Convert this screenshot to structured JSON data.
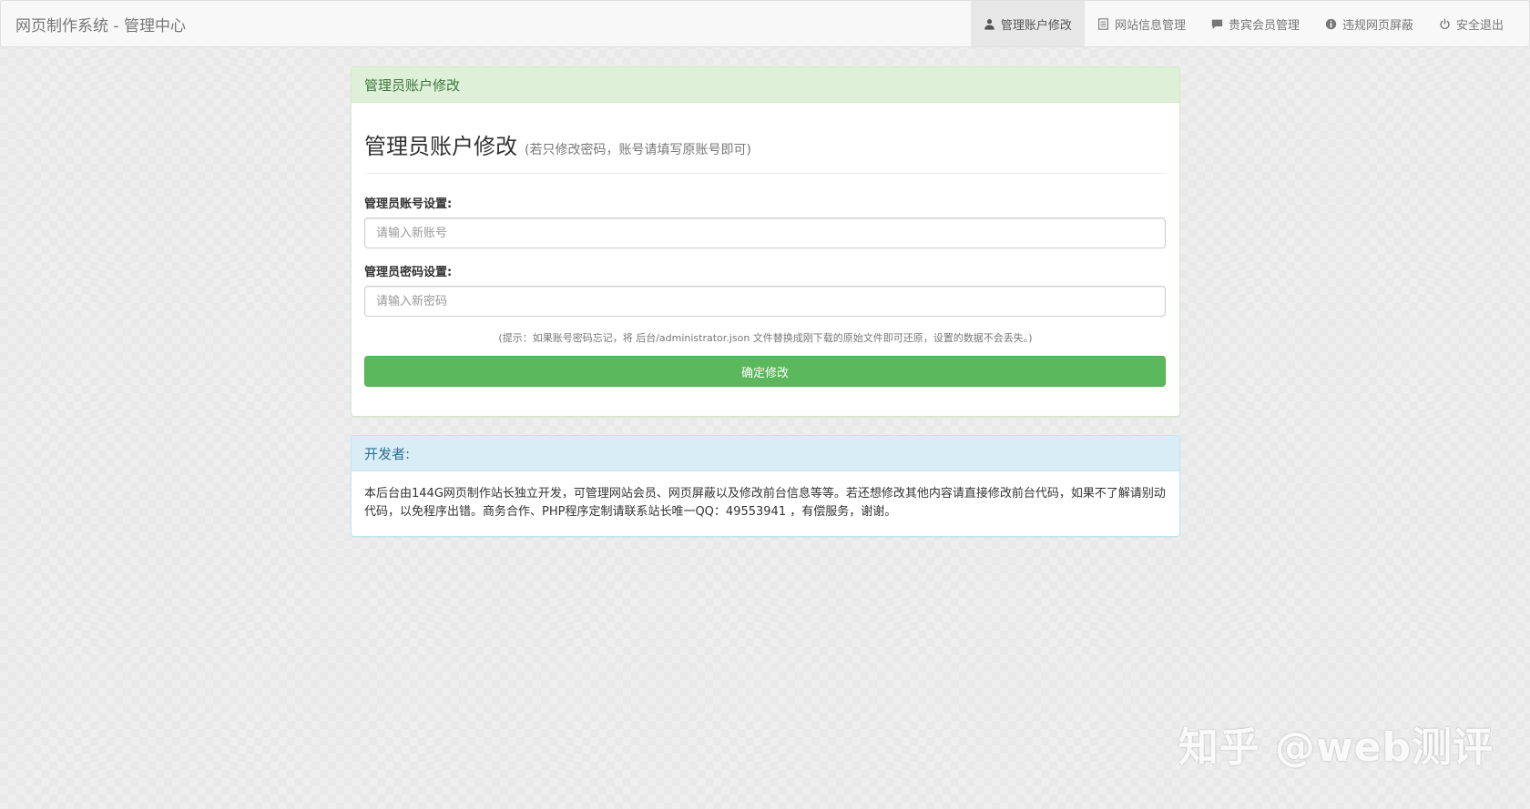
{
  "navbar": {
    "brand": "网页制作系统 - 管理中心",
    "items": [
      {
        "label": "管理账户修改",
        "icon": "user-icon"
      },
      {
        "label": "网站信息管理",
        "icon": "list-icon"
      },
      {
        "label": "贵宾会员管理",
        "icon": "comment-icon"
      },
      {
        "label": "违规网页屏蔽",
        "icon": "info-icon"
      },
      {
        "label": "安全退出",
        "icon": "power-icon"
      }
    ]
  },
  "account_panel": {
    "heading": "管理员账户修改",
    "title": "管理员账户修改",
    "subtitle": "(若只修改密码，账号请填写原账号即可)",
    "account_label": "管理员账号设置:",
    "account_placeholder": "请输入新账号",
    "account_value": "",
    "password_label": "管理员密码设置:",
    "password_placeholder": "请输入新密码",
    "password_value": "",
    "hint": "(提示：如果账号密码忘记，将 后台/administrator.json 文件替换成刚下载的原始文件即可还原，设置的数据不会丢失。)",
    "submit_label": "确定修改"
  },
  "developer_panel": {
    "heading": "开发者:",
    "text": "本后台由144G网页制作站长独立开发，可管理网站会员、网页屏蔽以及修改前台信息等等。若还想修改其他内容请直接修改前台代码，如果不了解请别动代码，以免程序出错。商务合作、PHP程序定制请联系站长唯一QQ：49553941 ，有偿服务，谢谢。"
  },
  "watermark": "知乎 @web测评"
}
